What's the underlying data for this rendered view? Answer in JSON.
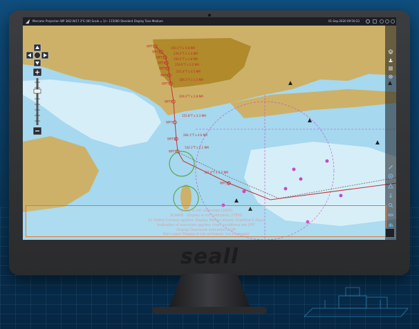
{
  "window": {
    "title": "Mercator Projection WP 38/2.N/17.3°E (W) Scale = 1/~ 115000 Standard Display Tove Medium",
    "date": "01-Sep-2020 09:50:23"
  },
  "brand": {
    "name": "seall"
  },
  "route": {
    "waypoints": [
      "WPT1",
      "WPT2",
      "WPT3",
      "WPT4",
      "WPT5",
      "WPT6",
      "WPT7",
      "WPT8",
      "WPT9",
      "WPT10",
      "WPT11",
      "WPT12"
    ],
    "legs": [
      "160.1°T x 0.8 NM",
      "239.2°T x 1.4 NM",
      "190.2°T x 1.8 NM",
      "218.6°T x 2.2 NM",
      "201.4°T x 3.5 NM",
      "189.1°T x 1.1 NM",
      "209.2°T x 2.8 NM",
      "155.8°T x 3.3 NM",
      "284.1°T x 4.6 NM",
      "142.1°T x 5.1 NM",
      "122.4°T x 3.2 NM"
    ]
  },
  "info_panel": {
    "lines": [
      "Safety is not calibrated (3000)",
      "SCAMIN - Display is not calibrated, 27850",
      "S1 Safety Contour applies; Display Meters ahead; Chartline 5 Days",
      "Indication of overscale applies; chart conditions are OFF",
      "Display Overscale indication is Off",
      "Rain Layer Display is not activated, (no coverage)"
    ]
  },
  "colors": {
    "water_deep": "#d6eef8",
    "water": "#a6d8ef",
    "land": "#cdb168",
    "land_built": "#b08a2b",
    "route": "#c43030",
    "track": "#7c7c7c",
    "accent_magenta": "#c24bc4"
  },
  "icons": {
    "logo": "app-logo-icon",
    "layers": "layers-icon",
    "settings": "gear-icon",
    "pan": "pan-arrows-icon",
    "zoom_in": "plus-icon",
    "zoom_out": "minus-icon"
  }
}
